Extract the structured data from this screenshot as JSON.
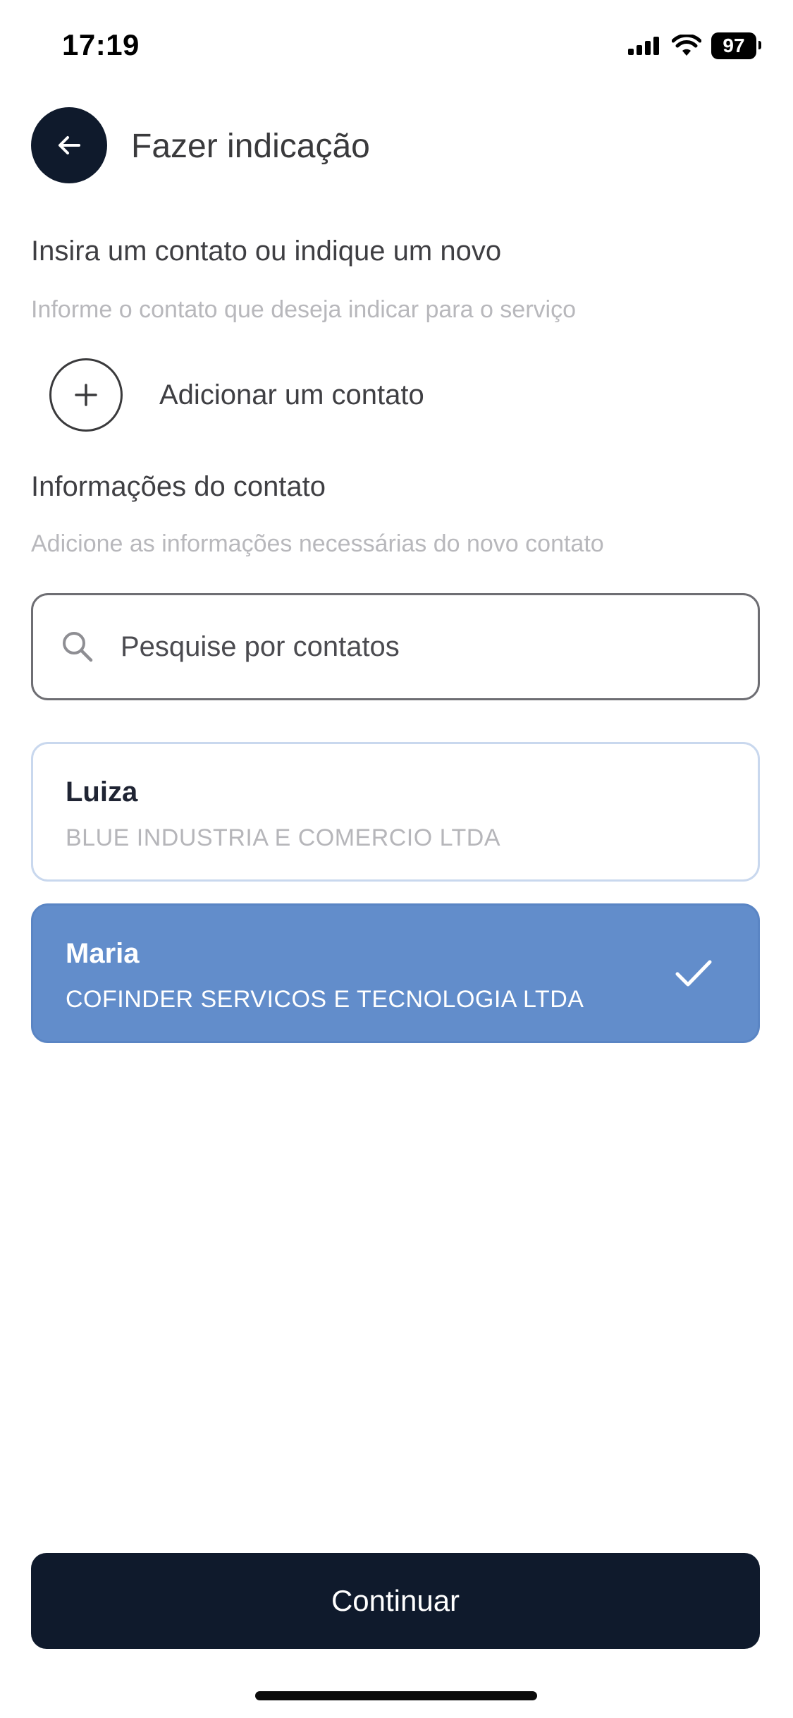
{
  "status_bar": {
    "time": "17:19",
    "battery": "97"
  },
  "header": {
    "title": "Fazer indicação",
    "back_icon": "arrow-left-icon"
  },
  "insert_section": {
    "title": "Insira um contato ou indique um novo",
    "subtitle": "Informe o contato que deseja indicar para o serviço"
  },
  "add_contact": {
    "label": "Adicionar um contato",
    "icon": "plus-icon"
  },
  "info_section": {
    "title": "Informações do contato",
    "subtitle": "Adicione as informações necessárias do novo contato"
  },
  "search": {
    "placeholder": "Pesquise por contatos",
    "value": ""
  },
  "contacts": [
    {
      "name": "Luiza",
      "company": "BLUE INDUSTRIA E COMERCIO LTDA",
      "selected": false
    },
    {
      "name": "Maria",
      "company": "COFINDER SERVICOS E TECNOLOGIA LTDA",
      "selected": true
    }
  ],
  "footer": {
    "continue_label": "Continuar"
  },
  "colors": {
    "primary_dark": "#0f1a2c",
    "selected_card": "#628dcb",
    "card_border": "#c9d8ee",
    "muted_text": "#b8b8bc"
  }
}
